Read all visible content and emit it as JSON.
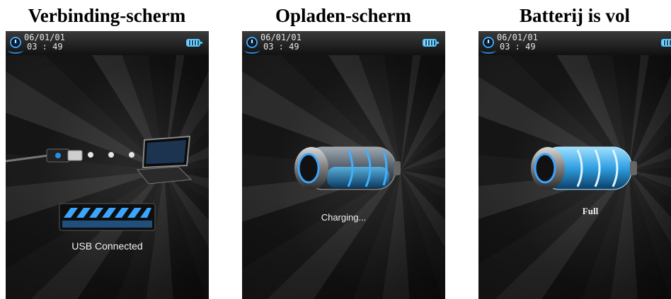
{
  "panels": [
    {
      "title": "Verbinding-scherm",
      "status": {
        "date": "06/01/01",
        "time": "03 : 49"
      },
      "caption": "USB Connected"
    },
    {
      "title": "Opladen-scherm",
      "status": {
        "date": "06/01/01",
        "time": "03 : 49"
      },
      "caption": "Charging..."
    },
    {
      "title": "Batterij is vol",
      "status": {
        "date": "06/01/01",
        "time": "03 : 49"
      },
      "caption": "Full"
    }
  ],
  "colors": {
    "accent_blue": "#3aa6ff",
    "battery_cyan": "#4fc3ff",
    "background_dark": "#1a1a1a"
  },
  "icons": [
    "clock-icon",
    "battery-status-icon",
    "usb-plug-icon",
    "laptop-icon",
    "battery-charging-icon",
    "battery-full-icon"
  ]
}
